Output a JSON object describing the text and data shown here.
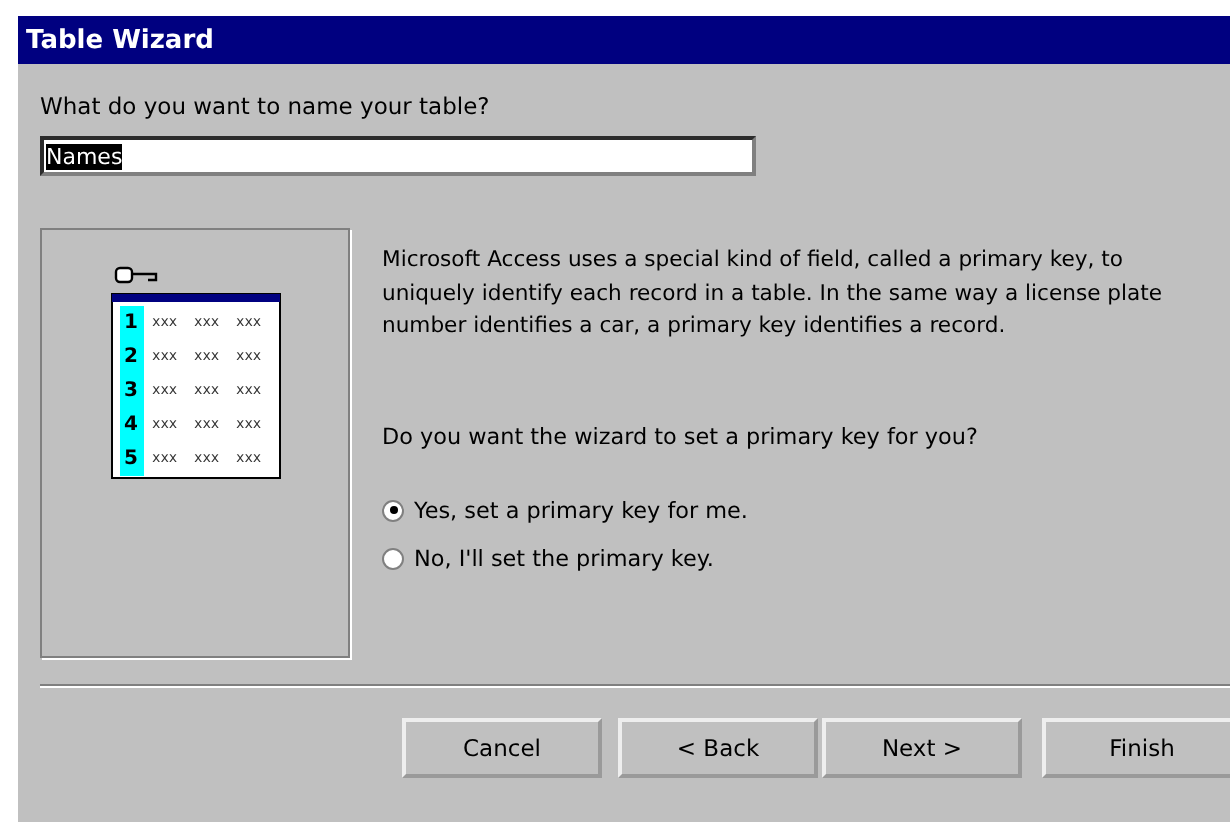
{
  "window": {
    "title": "Table Wizard"
  },
  "name_prompt": "What do you want to name your table?",
  "name_field": {
    "value": "Names",
    "selected": true
  },
  "illustration": {
    "rows": [
      {
        "number": "1",
        "cells": [
          "xxx",
          "xxx",
          "xxx"
        ]
      },
      {
        "number": "2",
        "cells": [
          "xxx",
          "xxx",
          "xxx"
        ]
      },
      {
        "number": "3",
        "cells": [
          "xxx",
          "xxx",
          "xxx"
        ]
      },
      {
        "number": "4",
        "cells": [
          "xxx",
          "xxx",
          "xxx"
        ]
      },
      {
        "number": "5",
        "cells": [
          "xxx",
          "xxx",
          "xxx"
        ]
      }
    ]
  },
  "description": "Microsoft Access uses a special kind of field, called a primary key, to uniquely identify each record in a table. In the same way a license plate number identifies a car, a primary key identifies a record.",
  "question": "Do you want the wizard to set a primary key for you?",
  "options": [
    {
      "label": "Yes, set a primary key for me.",
      "selected": true
    },
    {
      "label": "No, I'll set the primary key.",
      "selected": false
    }
  ],
  "buttons": [
    {
      "label": "Cancel"
    },
    {
      "label": "< Back"
    },
    {
      "label": "Next >"
    },
    {
      "label": "Finish"
    }
  ]
}
